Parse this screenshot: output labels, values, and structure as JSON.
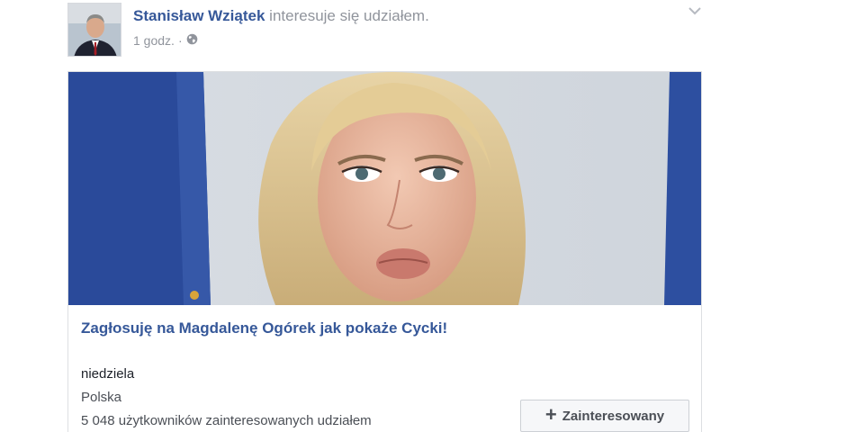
{
  "post": {
    "author": "Stanisław Wziątek",
    "action_text": "interesuje się udziałem.",
    "time": "1 godz.",
    "separator": "·",
    "privacy_icon": "globe-icon",
    "menu_icon": "chevron-down-icon"
  },
  "event": {
    "title": "Zagłosuję na Magdalenę Ogórek jak pokaże Cycki!",
    "day": "niedziela",
    "location": "Polska",
    "interested_count": "5 048 użytkowników zainteresowanych udziałem",
    "interest_button": {
      "icon": "plus-icon",
      "label": "Zainteresowany"
    }
  },
  "colors": {
    "link_blue": "#365899",
    "meta_gray": "#90949c",
    "flag_blue": "#2a4a9a",
    "button_bg": "#f6f7f9"
  }
}
